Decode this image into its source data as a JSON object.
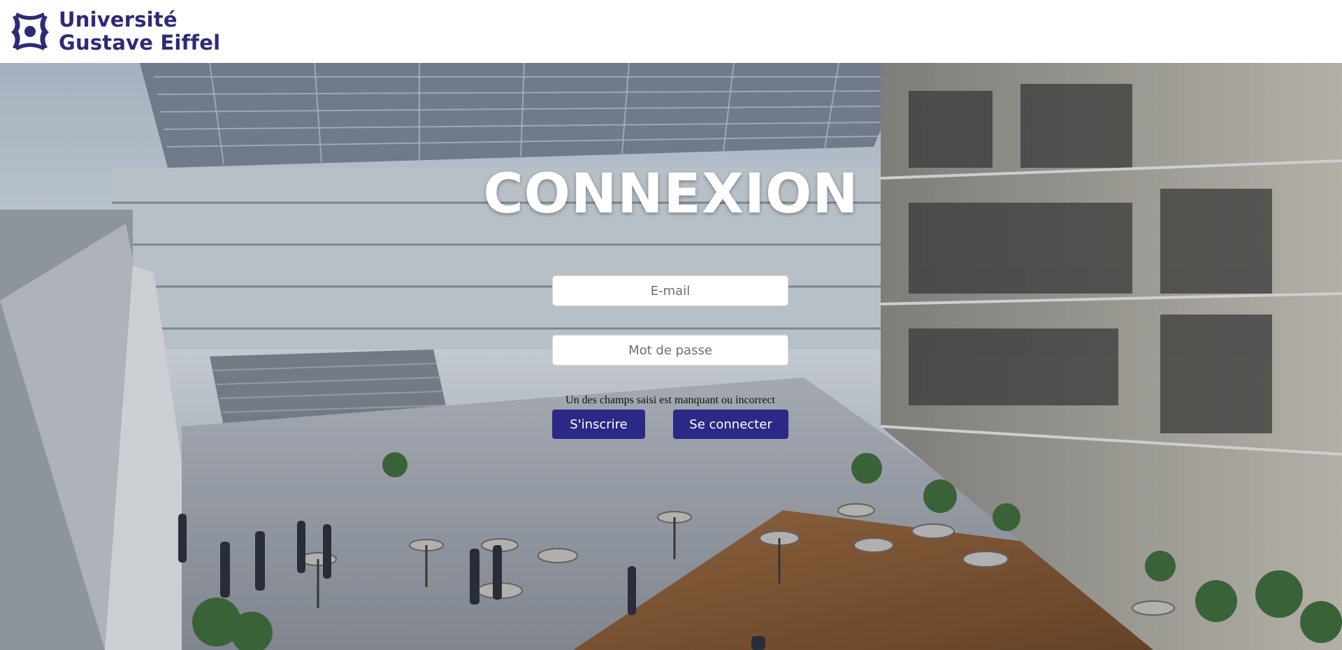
{
  "header": {
    "brand_line1": "Université",
    "brand_line2": "Gustave Eiffel",
    "logo_icon": "university-logo-icon",
    "brand_color": "#2e2a78"
  },
  "hero": {
    "background": "atrium-photo",
    "title": "CONNEXION"
  },
  "form": {
    "email_placeholder": "E-mail",
    "email_value": "",
    "password_placeholder": "Mot de passe",
    "password_value": "",
    "error_message": "Un des champs saisi est manquant ou incorrect",
    "signup_label": "S'inscrire",
    "login_label": "Se connecter",
    "button_color": "#2c2887"
  }
}
